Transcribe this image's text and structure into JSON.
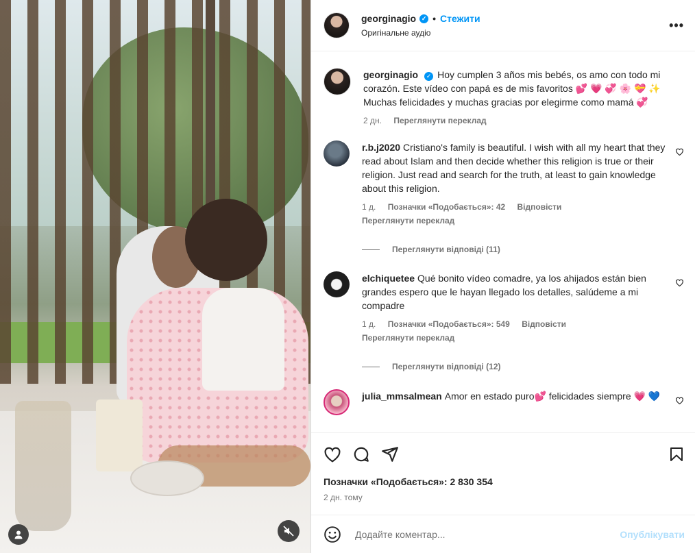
{
  "post": {
    "username": "georginagio",
    "follow_label": "Стежити",
    "audio": "Оригінальне аудіо",
    "caption": "Hoy cumplen 3 años mis bebés, os amo con todo mi corazón. Este vídeo con papá es de mis favoritos 💕 💗 💞 🌸 💝 ✨ Muchas felicidades y muchas gracias por elegirme como mamá 💞",
    "caption_age": "2 дн.",
    "caption_translate": "Переглянути переклад"
  },
  "comments": [
    {
      "username": "r.b.j2020",
      "text": "Cristiano's family is beautiful. I wish with all my heart that they read about Islam and then decide whether this religion is true or their religion. Just read and search for the truth, at least to gain knowledge about this religion.",
      "age": "1 д.",
      "likes": "Позначки «Подобається»: 42",
      "reply": "Відповісти",
      "translate": "Переглянути переклад",
      "view_replies": "Переглянути відповіді (11)"
    },
    {
      "username": "elchiquetee",
      "text": "Qué bonito vídeo comadre, ya los ahijados están bien grandes espero que le hayan llegado los detalles, salúdeme a mi compadre",
      "age": "1 д.",
      "likes": "Позначки «Подобається»: 549",
      "reply": "Відповісти",
      "translate": "Переглянути переклад",
      "view_replies": "Переглянути відповіді (12)"
    },
    {
      "username": "julia_mmsalmean",
      "text": "Amor en estado puro💕 felicidades siempre 💗 💙"
    }
  ],
  "footer": {
    "likes_total": "Позначки «Подобається»: 2 830 354",
    "posted_ago": "2 дн. тому",
    "comment_placeholder": "Додайте коментар...",
    "publish_label": "Опублікувати"
  },
  "icons": [
    "heart-icon",
    "comment-icon",
    "share-icon",
    "bookmark-icon",
    "emoji-icon",
    "more-icon",
    "verified-icon",
    "user-icon",
    "mute-icon"
  ]
}
